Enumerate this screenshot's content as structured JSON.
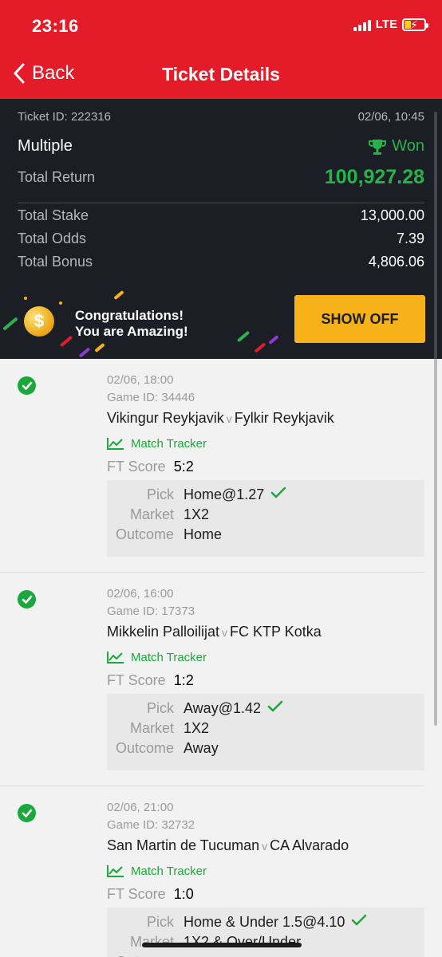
{
  "status": {
    "time": "23:16",
    "network": "LTE"
  },
  "nav": {
    "back": "Back",
    "title": "Ticket Details"
  },
  "ticket": {
    "id": "Ticket ID: 222316",
    "datetime": "02/06, 10:45",
    "type": "Multiple",
    "status": "Won",
    "return_label": "Total Return",
    "return_value": "100,927.28",
    "stake_label": "Total Stake",
    "stake_value": "13,000.00",
    "odds_label": "Total Odds",
    "odds_value": "7.39",
    "bonus_label": "Total Bonus",
    "bonus_value": "4,806.06"
  },
  "banner": {
    "line1": "Congratulations!",
    "line2": "You are Amazing!",
    "button": "SHOW OFF"
  },
  "colors": {
    "brand": "#e41b28",
    "panel": "#1c1e25",
    "won": "#27b34a",
    "accent": "#f7b21a"
  },
  "labels": {
    "tracker": "Match Tracker",
    "ft": "FT Score",
    "pick": "Pick",
    "market": "Market",
    "outcome": "Outcome",
    "vs": "v"
  },
  "selections": [
    {
      "date": "02/06, 18:00",
      "game_id": "Game ID: 34446",
      "home": "Vikingur Reykjavik",
      "away": "Fylkir Reykjavik",
      "score": "5:2",
      "pick": "Home@1.27",
      "market": "1X2",
      "outcome": "Home"
    },
    {
      "date": "02/06, 16:00",
      "game_id": "Game ID: 17373",
      "home": "Mikkelin Palloilijat",
      "away": "FC KTP Kotka",
      "score": "1:2",
      "pick": "Away@1.42",
      "market": "1X2",
      "outcome": "Away"
    },
    {
      "date": "02/06, 21:00",
      "game_id": "Game ID: 32732",
      "home": "San Martin de Tucuman",
      "away": "CA Alvarado",
      "score": "1:0",
      "pick": "Home & Under 1.5@4.10",
      "market": "1X2 & Over/Under",
      "outcome": ""
    }
  ]
}
